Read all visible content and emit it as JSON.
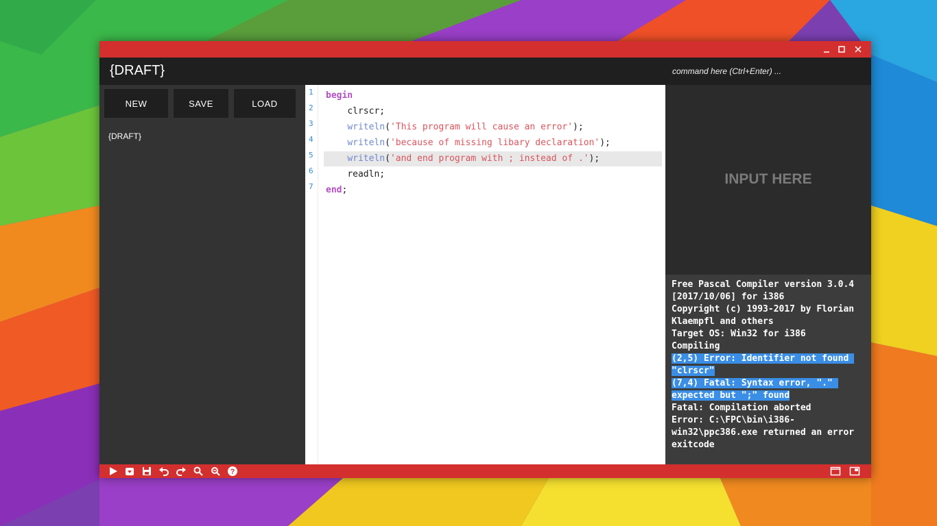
{
  "window": {
    "title": "{DRAFT}",
    "controls": {
      "minimize": "minimize-icon",
      "maximize": "maximize-icon",
      "close": "close-icon"
    }
  },
  "command": {
    "placeholder": "command here (Ctrl+Enter) ..."
  },
  "sidebar": {
    "buttons": [
      "NEW",
      "SAVE",
      "LOAD"
    ],
    "files": [
      "{DRAFT}"
    ]
  },
  "editor": {
    "line_numbers": [
      "1",
      "2",
      "3",
      "4",
      "5",
      "6",
      "7"
    ],
    "active_line": 5,
    "lines": [
      {
        "indent": "",
        "tokens": [
          {
            "t": "begin",
            "c": "kw"
          }
        ]
      },
      {
        "indent": "    ",
        "tokens": [
          {
            "t": "clrscr;",
            "c": "pn"
          }
        ]
      },
      {
        "indent": "    ",
        "tokens": [
          {
            "t": "writeln",
            "c": "fn"
          },
          {
            "t": "(",
            "c": "pn"
          },
          {
            "t": "'This program will cause an error'",
            "c": "str"
          },
          {
            "t": ");",
            "c": "pn"
          }
        ]
      },
      {
        "indent": "    ",
        "tokens": [
          {
            "t": "writeln",
            "c": "fn"
          },
          {
            "t": "(",
            "c": "pn"
          },
          {
            "t": "'because of missing libary declaration'",
            "c": "str"
          },
          {
            "t": ");",
            "c": "pn"
          }
        ]
      },
      {
        "indent": "    ",
        "tokens": [
          {
            "t": "writeln",
            "c": "fn"
          },
          {
            "t": "(",
            "c": "pn"
          },
          {
            "t": "'and end program with ; instead of .'",
            "c": "str"
          },
          {
            "t": ");",
            "c": "pn"
          }
        ]
      },
      {
        "indent": "    ",
        "tokens": [
          {
            "t": "readln;",
            "c": "pn"
          }
        ]
      },
      {
        "indent": "",
        "tokens": [
          {
            "t": "end",
            "c": "kw"
          },
          {
            "t": ";",
            "c": "pn"
          }
        ]
      }
    ]
  },
  "input_pane": {
    "label": "INPUT HERE"
  },
  "output": {
    "lines": [
      {
        "text": "Free Pascal Compiler version 3.0.4",
        "selected": false
      },
      {
        "text": "[2017/10/06] for i386",
        "selected": false
      },
      {
        "text": "Copyright (c) 1993-2017 by Florian",
        "selected": false
      },
      {
        "text": "Klaempfl and others",
        "selected": false
      },
      {
        "text": "Target OS: Win32 for i386",
        "selected": false
      },
      {
        "text": "Compiling",
        "selected": false
      },
      {
        "text": "(2,5) Error: Identifier not found ",
        "selected": true
      },
      {
        "text": "\"clrscr\"",
        "selected": true
      },
      {
        "text": "(7,4) Fatal: Syntax error, \".\" ",
        "selected": true
      },
      {
        "text": "expected but \";\" found",
        "selected": true
      },
      {
        "text": "Fatal: Compilation aborted",
        "selected": false
      },
      {
        "text": "Error: C:\\FPC\\bin\\i386-",
        "selected": false
      },
      {
        "text": "win32\\ppc386.exe returned an error",
        "selected": false
      },
      {
        "text": "exitcode",
        "selected": false
      }
    ]
  },
  "toolbar": {
    "left_icons": [
      "run-icon",
      "compile-icon",
      "save-icon",
      "undo-icon",
      "redo-icon",
      "search-icon",
      "replace-icon",
      "help-icon"
    ],
    "right_icons": [
      "window-mode-icon",
      "split-view-icon"
    ]
  },
  "colors": {
    "accent": "#d32f2f",
    "header": "#1f1f1f",
    "sidebar": "#333333",
    "editor_bg": "#ffffff",
    "keyword": "#b04fc0",
    "function": "#6f88cc",
    "string": "#d9545c",
    "line_number": "#2d8bd8",
    "selection": "#3a8ee6"
  }
}
